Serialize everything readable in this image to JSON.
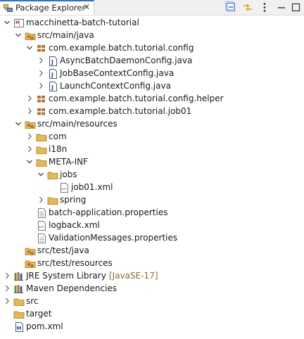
{
  "view": {
    "title": "Package Explorer",
    "close_glyph": "✕"
  },
  "toolbar": {
    "icons": [
      "collapse-all-icon",
      "link-with-editor-icon",
      "view-menu-icon"
    ]
  },
  "tree": [
    {
      "label": "macchinetta-batch-tutorial",
      "icon": "maven-project-icon",
      "expanded": true
    },
    {
      "label": "src/main/java",
      "icon": "source-folder-icon",
      "expanded": true
    },
    {
      "label": "com.example.batch.tutorial.config",
      "icon": "package-icon",
      "expanded": true
    },
    {
      "label": "AsyncBatchDaemonConfig.java",
      "icon": "java-file-icon",
      "expanded": false
    },
    {
      "label": "JobBaseContextConfig.java",
      "icon": "java-file-icon",
      "expanded": false
    },
    {
      "label": "LaunchContextConfig.java",
      "icon": "java-file-icon",
      "expanded": false
    },
    {
      "label": "com.example.batch.tutorial.config.helper",
      "icon": "package-icon",
      "expanded": false
    },
    {
      "label": "com.example.batch.tutorial.job01",
      "icon": "package-icon",
      "expanded": false
    },
    {
      "label": "src/main/resources",
      "icon": "source-folder-icon",
      "expanded": true
    },
    {
      "label": "com",
      "icon": "folder-icon",
      "expanded": false
    },
    {
      "label": "i18n",
      "icon": "folder-icon",
      "expanded": false
    },
    {
      "label": "META-INF",
      "icon": "folder-icon",
      "expanded": true
    },
    {
      "label": "jobs",
      "icon": "folder-icon",
      "expanded": true
    },
    {
      "label": "job01.xml",
      "icon": "xml-file-icon",
      "expanded": false
    },
    {
      "label": "spring",
      "icon": "folder-icon",
      "expanded": false
    },
    {
      "label": "batch-application.properties",
      "icon": "properties-file-icon",
      "expanded": false
    },
    {
      "label": "logback.xml",
      "icon": "xml-file-icon",
      "expanded": false
    },
    {
      "label": "ValidationMessages.properties",
      "icon": "properties-file-icon",
      "expanded": false
    },
    {
      "label": "src/test/java",
      "icon": "source-folder-icon",
      "expanded": false
    },
    {
      "label": "src/test/resources",
      "icon": "source-folder-icon",
      "expanded": false
    },
    {
      "label": "JRE System Library",
      "decoration": "[JavaSE-17]",
      "icon": "library-icon",
      "expanded": false
    },
    {
      "label": "Maven Dependencies",
      "icon": "library-icon",
      "expanded": false
    },
    {
      "label": "src",
      "icon": "folder-icon",
      "expanded": false
    },
    {
      "label": "target",
      "icon": "folder-icon",
      "expanded": false
    },
    {
      "label": "pom.xml",
      "icon": "maven-pom-icon",
      "expanded": false
    }
  ],
  "colors": {
    "accent": "#2f6fd6",
    "folder": "#e8b84e",
    "package": "#b5733a",
    "decoration": "#8a6d2f"
  }
}
